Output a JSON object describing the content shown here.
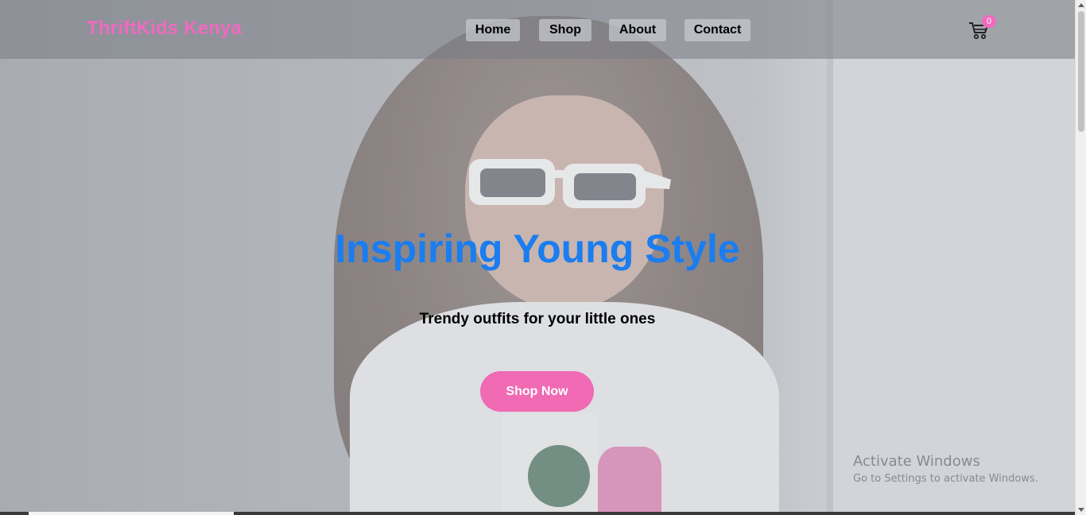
{
  "navbar": {
    "brand": "ThriftKids Kenya",
    "links": [
      {
        "label": "Home"
      },
      {
        "label": "Shop"
      },
      {
        "label": "About"
      },
      {
        "label": "Contact"
      }
    ],
    "cart": {
      "icon": "cart-icon",
      "count": "0"
    }
  },
  "hero": {
    "headline": "Inspiring Young Style",
    "subheadline": "Trendy outfits for your little ones",
    "cta_label": "Shop Now",
    "image": "hero-background-image"
  },
  "watermark": {
    "title": "Activate Windows",
    "subtitle": "Go to Settings to activate Windows."
  },
  "colors": {
    "brand_pink": "#f06ac0",
    "headline_blue": "#1a7df0",
    "button_pink": "#f06ab4"
  }
}
